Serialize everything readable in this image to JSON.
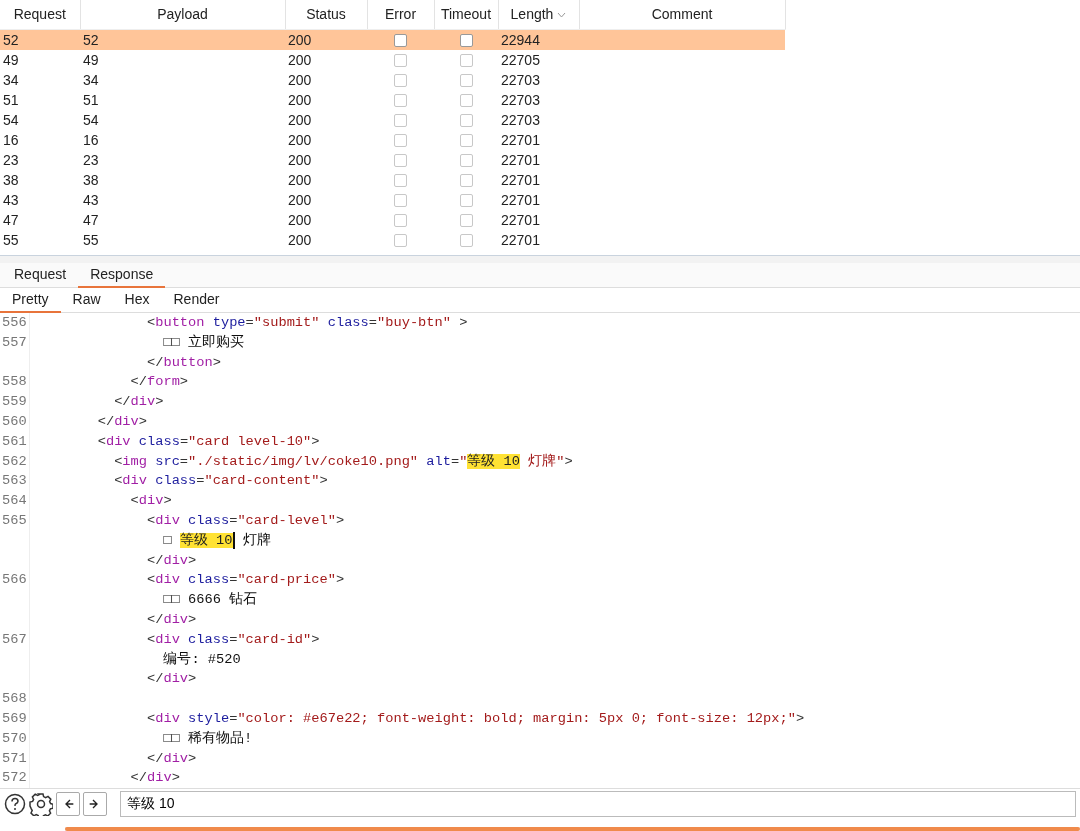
{
  "results_table": {
    "columns": [
      {
        "label": "Request",
        "sorted": false
      },
      {
        "label": "Payload",
        "sorted": false
      },
      {
        "label": "Status",
        "sorted": false
      },
      {
        "label": "Error",
        "sorted": false
      },
      {
        "label": "Timeout",
        "sorted": false
      },
      {
        "label": "Length",
        "sorted": true
      },
      {
        "label": "Comment",
        "sorted": false
      }
    ],
    "rows": [
      {
        "request": "52",
        "payload": "52",
        "status": "200",
        "error": false,
        "timeout": false,
        "length": "22944",
        "selected": true
      },
      {
        "request": "49",
        "payload": "49",
        "status": "200",
        "error": false,
        "timeout": false,
        "length": "22705",
        "selected": false
      },
      {
        "request": "34",
        "payload": "34",
        "status": "200",
        "error": false,
        "timeout": false,
        "length": "22703",
        "selected": false
      },
      {
        "request": "51",
        "payload": "51",
        "status": "200",
        "error": false,
        "timeout": false,
        "length": "22703",
        "selected": false
      },
      {
        "request": "54",
        "payload": "54",
        "status": "200",
        "error": false,
        "timeout": false,
        "length": "22703",
        "selected": false
      },
      {
        "request": "16",
        "payload": "16",
        "status": "200",
        "error": false,
        "timeout": false,
        "length": "22701",
        "selected": false
      },
      {
        "request": "23",
        "payload": "23",
        "status": "200",
        "error": false,
        "timeout": false,
        "length": "22701",
        "selected": false
      },
      {
        "request": "38",
        "payload": "38",
        "status": "200",
        "error": false,
        "timeout": false,
        "length": "22701",
        "selected": false
      },
      {
        "request": "43",
        "payload": "43",
        "status": "200",
        "error": false,
        "timeout": false,
        "length": "22701",
        "selected": false
      },
      {
        "request": "47",
        "payload": "47",
        "status": "200",
        "error": false,
        "timeout": false,
        "length": "22701",
        "selected": false
      },
      {
        "request": "55",
        "payload": "55",
        "status": "200",
        "error": false,
        "timeout": false,
        "length": "22701",
        "selected": false
      }
    ]
  },
  "message_tabs": [
    {
      "label": "Request",
      "selected": false
    },
    {
      "label": "Response",
      "selected": true
    }
  ],
  "view_tabs": [
    {
      "label": "Pretty",
      "selected": true
    },
    {
      "label": "Raw",
      "selected": false
    },
    {
      "label": "Hex",
      "selected": false
    },
    {
      "label": "Render",
      "selected": false
    }
  ],
  "code_lines": [
    {
      "children": [
        {
          "children": [
            {
              "children": [
                {
                  "num": "556",
                  "code": [
                    {
                      "kind": "punct",
                      "text": "<"
                    },
                    {
                      "kind": "tag",
                      "text": "button"
                    },
                    {
                      "kind": "attr",
                      "text": " type"
                    },
                    {
                      "kind": "punct",
                      "text": "="
                    },
                    {
                      "kind": "value",
                      "text": "\"submit\""
                    },
                    {
                      "kind": "attr",
                      "text": " class"
                    },
                    {
                      "kind": "punct",
                      "text": "="
                    },
                    {
                      "kind": "value",
                      "text": "\"buy-btn\""
                    },
                    {
                      "kind": "punct",
                      "text": " >"
                    }
                  ],
                  "children": [
                    {
                      "num": "557",
                      "code": [
                        {
                          "kind": "text",
                          "text": "□□ 立即购买"
                        }
                      ]
                    }
                  ]
                },
                {
                  "code": [
                    {
                      "kind": "punct",
                      "text": "</"
                    },
                    {
                      "kind": "tag",
                      "text": "button"
                    },
                    {
                      "kind": "punct",
                      "text": ">"
                    }
                  ]
                }
              ]
            },
            {
              "num": "558",
              "code": [
                {
                  "kind": "punct",
                  "text": "</"
                },
                {
                  "kind": "tag",
                  "text": "form"
                },
                {
                  "kind": "punct",
                  "text": ">"
                }
              ]
            }
          ]
        },
        {
          "num": "559",
          "code": [
            {
              "kind": "punct",
              "text": "</"
            },
            {
              "kind": "tag",
              "text": "div"
            },
            {
              "kind": "punct",
              "text": ">"
            }
          ]
        }
      ]
    },
    {
      "num": "560",
      "code": [
        {
          "kind": "punct",
          "text": "</"
        },
        {
          "kind": "tag",
          "text": "div"
        },
        {
          "kind": "punct",
          "text": ">"
        }
      ]
    },
    {
      "num": "561",
      "code": [
        {
          "kind": "punct",
          "text": "<"
        },
        {
          "kind": "tag",
          "text": "div"
        },
        {
          "kind": "attr",
          "text": " class"
        },
        {
          "kind": "punct",
          "text": "="
        },
        {
          "kind": "value",
          "text": "\"card level-10\""
        },
        {
          "kind": "punct",
          "text": ">"
        }
      ],
      "children": [
        {
          "num": "562",
          "code": [
            {
              "kind": "punct",
              "text": "<"
            },
            {
              "kind": "tag",
              "text": "img"
            },
            {
              "kind": "attr",
              "text": " src"
            },
            {
              "kind": "punct",
              "text": "="
            },
            {
              "kind": "value",
              "text": "\"./static/img/lv/coke10.png\""
            },
            {
              "kind": "attr",
              "text": " alt"
            },
            {
              "kind": "punct",
              "text": "="
            },
            {
              "kind": "value",
              "text": "\""
            },
            {
              "kind": "highlight",
              "text": "等级 10"
            },
            {
              "kind": "value",
              "text": " 灯牌\""
            },
            {
              "kind": "punct",
              "text": ">"
            }
          ]
        },
        {
          "num": "563",
          "code": [
            {
              "kind": "punct",
              "text": "<"
            },
            {
              "kind": "tag",
              "text": "div"
            },
            {
              "kind": "attr",
              "text": " class"
            },
            {
              "kind": "punct",
              "text": "="
            },
            {
              "kind": "value",
              "text": "\"card-content\""
            },
            {
              "kind": "punct",
              "text": ">"
            }
          ],
          "children": [
            {
              "num": "564",
              "code": [
                {
                  "kind": "punct",
                  "text": "<"
                },
                {
                  "kind": "tag",
                  "text": "div"
                },
                {
                  "kind": "punct",
                  "text": ">"
                }
              ],
              "children": [
                {
                  "num": "565",
                  "code": [
                    {
                      "kind": "punct",
                      "text": "<"
                    },
                    {
                      "kind": "tag",
                      "text": "div"
                    },
                    {
                      "kind": "attr",
                      "text": " class"
                    },
                    {
                      "kind": "punct",
                      "text": "="
                    },
                    {
                      "kind": "value",
                      "text": "\"card-level\""
                    },
                    {
                      "kind": "punct",
                      "text": ">"
                    }
                  ],
                  "children": [
                    {
                      "code": [
                        {
                          "kind": "text",
                          "text": "□ "
                        },
                        {
                          "kind": "highlight",
                          "text": "等级 10"
                        },
                        {
                          "kind": "cursor"
                        },
                        {
                          "kind": "text",
                          "text": " 灯牌"
                        }
                      ]
                    }
                  ]
                },
                {
                  "code": [
                    {
                      "kind": "punct",
                      "text": "</"
                    },
                    {
                      "kind": "tag",
                      "text": "div"
                    },
                    {
                      "kind": "punct",
                      "text": ">"
                    }
                  ]
                },
                {
                  "num": "566",
                  "code": [
                    {
                      "kind": "punct",
                      "text": "<"
                    },
                    {
                      "kind": "tag",
                      "text": "div"
                    },
                    {
                      "kind": "attr",
                      "text": " class"
                    },
                    {
                      "kind": "punct",
                      "text": "="
                    },
                    {
                      "kind": "value",
                      "text": "\"card-price\""
                    },
                    {
                      "kind": "punct",
                      "text": ">"
                    }
                  ],
                  "children": [
                    {
                      "code": [
                        {
                          "kind": "text",
                          "text": "□□ 6666 钻石"
                        }
                      ]
                    }
                  ]
                },
                {
                  "code": [
                    {
                      "kind": "punct",
                      "text": "</"
                    },
                    {
                      "kind": "tag",
                      "text": "div"
                    },
                    {
                      "kind": "punct",
                      "text": ">"
                    }
                  ]
                },
                {
                  "num": "567",
                  "code": [
                    {
                      "kind": "punct",
                      "text": "<"
                    },
                    {
                      "kind": "tag",
                      "text": "div"
                    },
                    {
                      "kind": "attr",
                      "text": " class"
                    },
                    {
                      "kind": "punct",
                      "text": "="
                    },
                    {
                      "kind": "value",
                      "text": "\"card-id\""
                    },
                    {
                      "kind": "punct",
                      "text": ">"
                    }
                  ],
                  "children": [
                    {
                      "code": [
                        {
                          "kind": "text",
                          "text": "编号: #520"
                        }
                      ]
                    }
                  ]
                },
                {
                  "code": [
                    {
                      "kind": "punct",
                      "text": "</"
                    },
                    {
                      "kind": "tag",
                      "text": "div"
                    },
                    {
                      "kind": "punct",
                      "text": ">"
                    }
                  ]
                },
                {
                  "num": "568"
                },
                {
                  "num": "569",
                  "code": [
                    {
                      "kind": "punct",
                      "text": "<"
                    },
                    {
                      "kind": "tag",
                      "text": "div"
                    },
                    {
                      "kind": "attr",
                      "text": " style"
                    },
                    {
                      "kind": "punct",
                      "text": "="
                    },
                    {
                      "kind": "value",
                      "text": "\"color: #e67e22; font-weight: bold; margin: 5px 0; font-size: 12px;\""
                    },
                    {
                      "kind": "punct",
                      "text": ">"
                    }
                  ],
                  "children": [
                    {
                      "num": "570",
                      "code": [
                        {
                          "kind": "text",
                          "text": "□□ 稀有物品!"
                        }
                      ]
                    }
                  ]
                },
                {
                  "num": "571",
                  "code": [
                    {
                      "kind": "punct",
                      "text": "</"
                    },
                    {
                      "kind": "tag",
                      "text": "div"
                    },
                    {
                      "kind": "punct",
                      "text": ">"
                    }
                  ]
                }
              ]
            },
            {
              "num": "572",
              "code": [
                {
                  "kind": "punct",
                  "text": "</"
                },
                {
                  "kind": "tag",
                  "text": "div"
                },
                {
                  "kind": "punct",
                  "text": ">"
                }
              ]
            }
          ]
        }
      ]
    }
  ],
  "search": {
    "value": "等级 10"
  },
  "progress": {
    "level": 1
  }
}
